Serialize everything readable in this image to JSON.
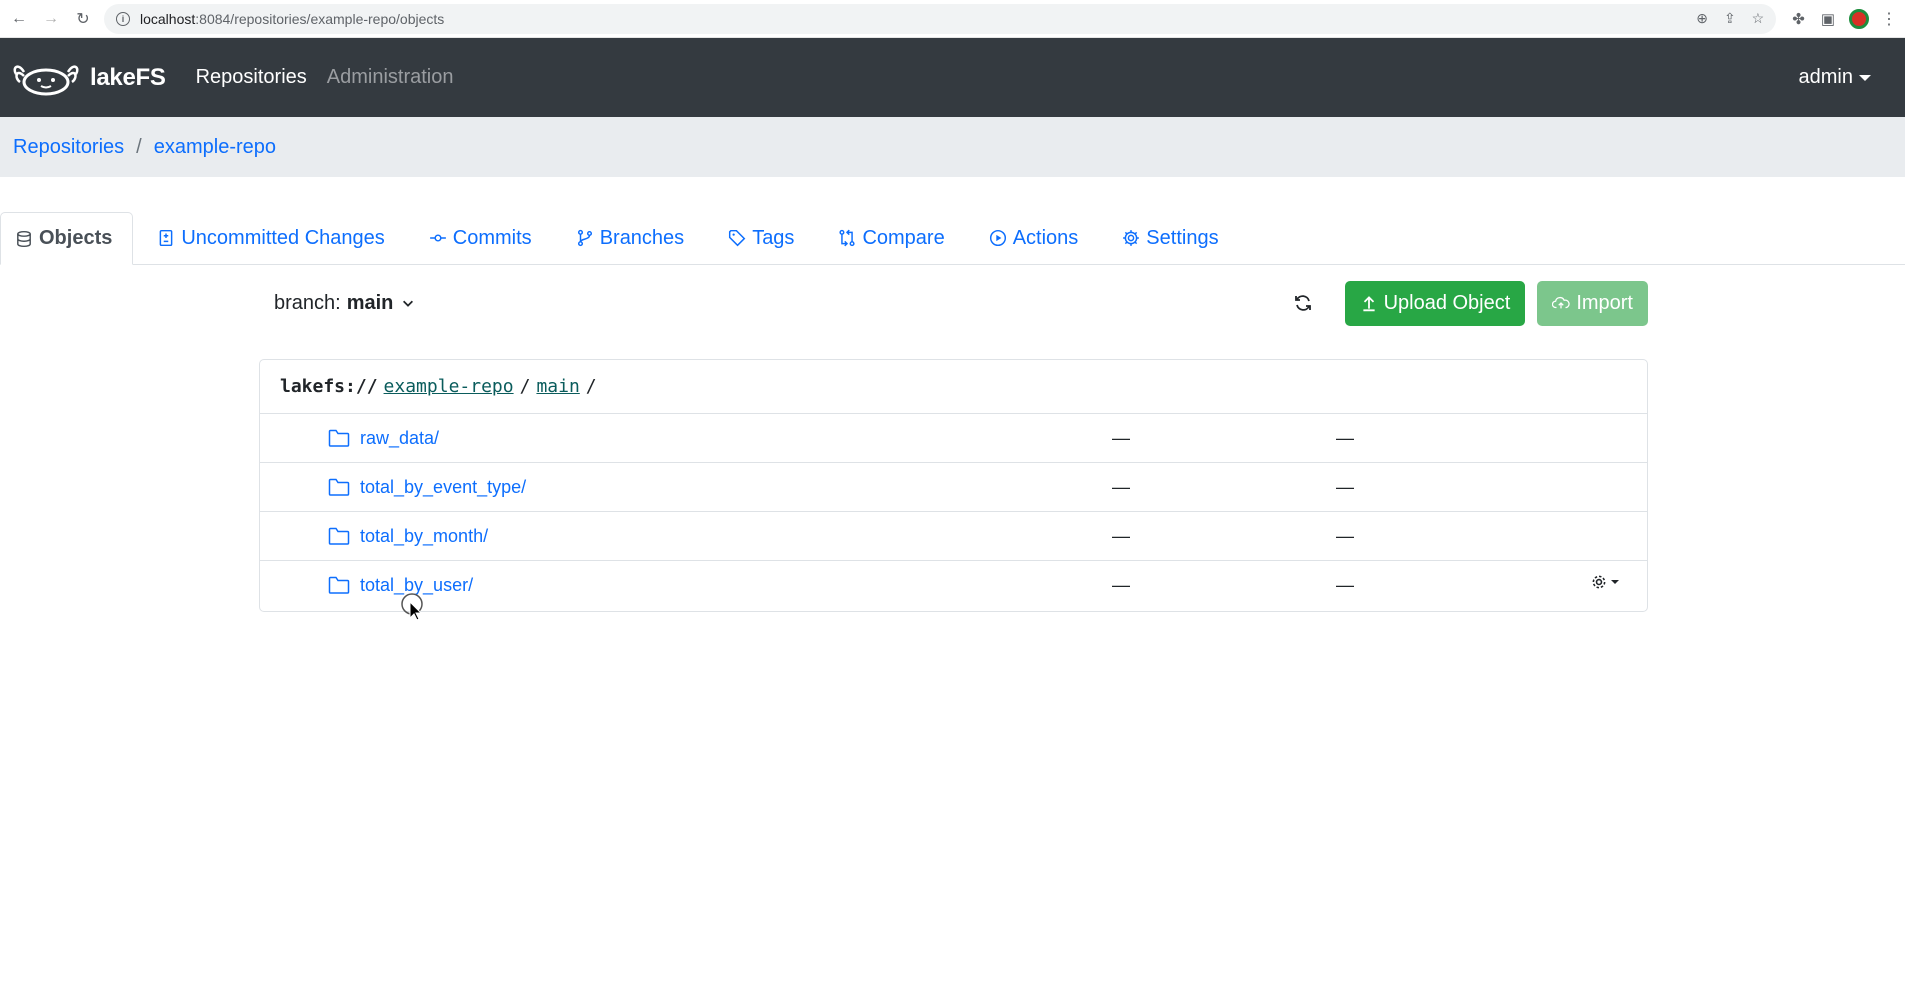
{
  "browser": {
    "url_host": "localhost",
    "url_path": ":8084/repositories/example-repo/objects"
  },
  "navbar": {
    "brand": "lakeFS",
    "links": [
      "Repositories",
      "Administration"
    ],
    "user": "admin"
  },
  "breadcrumb": {
    "items": [
      "Repositories",
      "example-repo"
    ],
    "separator": "/"
  },
  "tabs": [
    {
      "label": "Objects",
      "icon": "database-icon",
      "active": true
    },
    {
      "label": "Uncommitted Changes",
      "icon": "file-diff-icon"
    },
    {
      "label": "Commits",
      "icon": "commit-icon"
    },
    {
      "label": "Branches",
      "icon": "branch-icon"
    },
    {
      "label": "Tags",
      "icon": "tag-icon"
    },
    {
      "label": "Compare",
      "icon": "compare-icon"
    },
    {
      "label": "Actions",
      "icon": "play-icon"
    },
    {
      "label": "Settings",
      "icon": "gear-icon"
    }
  ],
  "toolbar": {
    "branch_prefix": "branch:",
    "branch_name": "main",
    "upload_label": "Upload Object",
    "import_label": "Import"
  },
  "path": {
    "protocol": "lakefs://",
    "repo": "example-repo",
    "ref": "main",
    "sep": "/"
  },
  "objects": [
    {
      "name": "raw_data/",
      "col2": "—",
      "col3": "—"
    },
    {
      "name": "total_by_event_type/",
      "col2": "—",
      "col3": "—"
    },
    {
      "name": "total_by_month/",
      "col2": "—",
      "col3": "—"
    },
    {
      "name": "total_by_user/",
      "col2": "—",
      "col3": "—"
    }
  ],
  "colors": {
    "navbar": "#343a40",
    "link": "#0d6efd",
    "upload": "#28a745",
    "import": "#7cc68c"
  }
}
